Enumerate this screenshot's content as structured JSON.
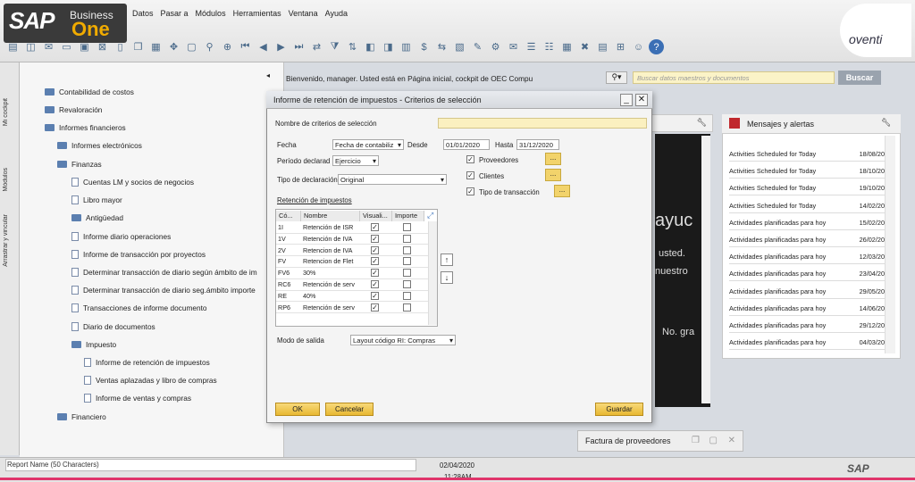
{
  "app": {
    "brand_sap": "SAP",
    "brand_business": "Business",
    "brand_one": "One",
    "corner_logo": "oventi"
  },
  "menu": [
    "Datos",
    "Pasar a",
    "Módulos",
    "Herramientas",
    "Ventana",
    "Ayuda"
  ],
  "sidetabs": [
    "Mi cockpit",
    "Módulos",
    "Arrastrar y vincular"
  ],
  "nav": [
    {
      "label": "Contabilidad de costos",
      "icon": "folder"
    },
    {
      "label": "Revaloración",
      "icon": "folder"
    },
    {
      "label": "Informes financieros",
      "icon": "folder-open"
    },
    {
      "label": "Informes electrónicos",
      "icon": "folder"
    },
    {
      "label": "Finanzas",
      "icon": "folder-open"
    },
    {
      "label": "Cuentas LM y socios de negocios",
      "icon": "doc"
    },
    {
      "label": "Libro mayor",
      "icon": "doc"
    },
    {
      "label": "Antigüedad",
      "icon": "folder"
    },
    {
      "label": "Informe diario operaciones",
      "icon": "doc"
    },
    {
      "label": "Informe de transacción por proyectos",
      "icon": "doc"
    },
    {
      "label": "Determinar transacción de diario según ámbito de im",
      "icon": "doc"
    },
    {
      "label": "Determinar transacción de diario seg.ámbito importe",
      "icon": "doc"
    },
    {
      "label": "Transacciones de informe documento",
      "icon": "doc"
    },
    {
      "label": "Diario de documentos",
      "icon": "doc"
    },
    {
      "label": "Impuesto",
      "icon": "folder-open"
    },
    {
      "label": "Informe de retención de impuestos",
      "icon": "doc"
    },
    {
      "label": "Ventas aplazadas y libro de compras",
      "icon": "doc"
    },
    {
      "label": "Informe de ventas y compras",
      "icon": "doc"
    },
    {
      "label": "Financiero",
      "icon": "folder"
    }
  ],
  "cockpit": {
    "welcome": "Bienvenido, manager. Usted está en Página inicial, cockpit de OEC Compu",
    "search_placeholder": "Buscar datos maestros y documentos",
    "search_button": "Buscar",
    "dark_text": [
      "ayuc",
      "usted.",
      "nuestro",
      "No. gra"
    ],
    "factura": "Factura de proveedores"
  },
  "messages": {
    "title": "Mensajes y alertas",
    "rows": [
      {
        "text": "Activities Scheduled for Today",
        "date": "18/08/20"
      },
      {
        "text": "Activities Scheduled for Today",
        "date": "18/10/20"
      },
      {
        "text": "Activities Scheduled for Today",
        "date": "19/10/20"
      },
      {
        "text": "Activities Scheduled for Today",
        "date": "14/02/20"
      },
      {
        "text": "Actividades planificadas para hoy",
        "date": "15/02/20"
      },
      {
        "text": "Actividades planificadas para hoy",
        "date": "26/02/20"
      },
      {
        "text": "Actividades planificadas para hoy",
        "date": "12/03/20"
      },
      {
        "text": "Actividades planificadas para hoy",
        "date": "23/04/20"
      },
      {
        "text": "Actividades planificadas para hoy",
        "date": "29/05/20"
      },
      {
        "text": "Actividades planificadas para hoy",
        "date": "14/06/20"
      },
      {
        "text": "Actividades planificadas para hoy",
        "date": "29/12/20"
      },
      {
        "text": "Actividades planificadas para hoy",
        "date": "04/03/20"
      }
    ]
  },
  "dialog": {
    "title": "Informe de retención de impuestos - Criterios de selección",
    "criteria_name_label": "Nombre de criterios de selección",
    "fecha_label": "Fecha",
    "fecha_value": "Fecha de contabiliz",
    "desde_label": "Desde",
    "desde_value": "01/01/2020",
    "hasta_label": "Hasta",
    "hasta_value": "31/12/2020",
    "periodo_label": "Período declarad",
    "periodo_value": "Ejercicio",
    "tipo_label": "Tipo de declaración",
    "tipo_value": "Original",
    "retencion_label": "Retención de impuestos",
    "proveedores": "Proveedores",
    "clientes": "Clientes",
    "tipo_transaccion": "Tipo de transacción",
    "columns": [
      "Có...",
      "Nombre",
      "Visuali...",
      "Importe"
    ],
    "rows": [
      {
        "code": "1I",
        "name": "Retención de ISR"
      },
      {
        "code": "1V",
        "name": "Retención de IVA"
      },
      {
        "code": "2V",
        "name": "Retencion de IVA"
      },
      {
        "code": "FV",
        "name": "Retencion de Flet"
      },
      {
        "code": "FV6",
        "name": "30%"
      },
      {
        "code": "RC6",
        "name": "Retención de serv"
      },
      {
        "code": "RE",
        "name": "40%"
      },
      {
        "code": "RP6",
        "name": "Retención de serv"
      }
    ],
    "modo_label": "Modo de salida",
    "modo_value": "Layout código RI: Compras",
    "ok": "OK",
    "cancel": "Cancelar",
    "save": "Guardar"
  },
  "status": {
    "report_name": "Report Name (50 Characters)",
    "date": "02/04/2020",
    "time": "11:28AM",
    "sap_small": "SAP"
  },
  "colors": {
    "accent": "#f0ab00",
    "button": "#e8b832",
    "alert": "#c0282d",
    "statusline": "#e0356b"
  }
}
